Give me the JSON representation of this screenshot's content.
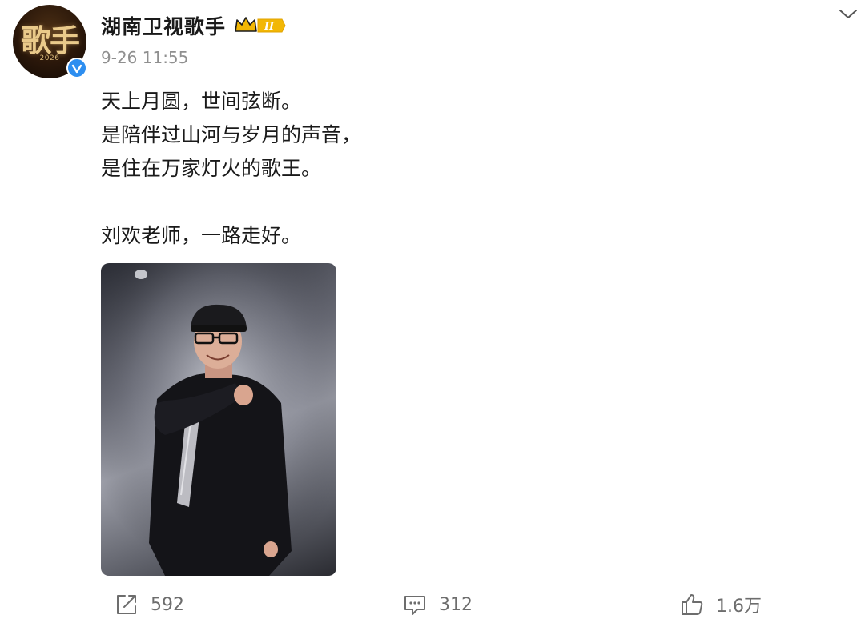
{
  "account": {
    "avatar_text": "歌手",
    "avatar_year": "2026",
    "name": "湖南卫视歌手",
    "vip_level": "II",
    "timestamp": "9-26 11:55"
  },
  "post": {
    "lines": [
      "天上月圆，世间弦断。",
      "是陪伴过山河与岁月的声音，",
      "是住在万家灯火的歌王。",
      "",
      "刘欢老师，一路走好。"
    ]
  },
  "actions": {
    "repost_count": "592",
    "comment_count": "312",
    "like_count": "1.6万"
  },
  "colors": {
    "verified_blue": "#2d8ef0",
    "vip_gold": "#f2b705",
    "muted_text": "#8f8f8f"
  }
}
